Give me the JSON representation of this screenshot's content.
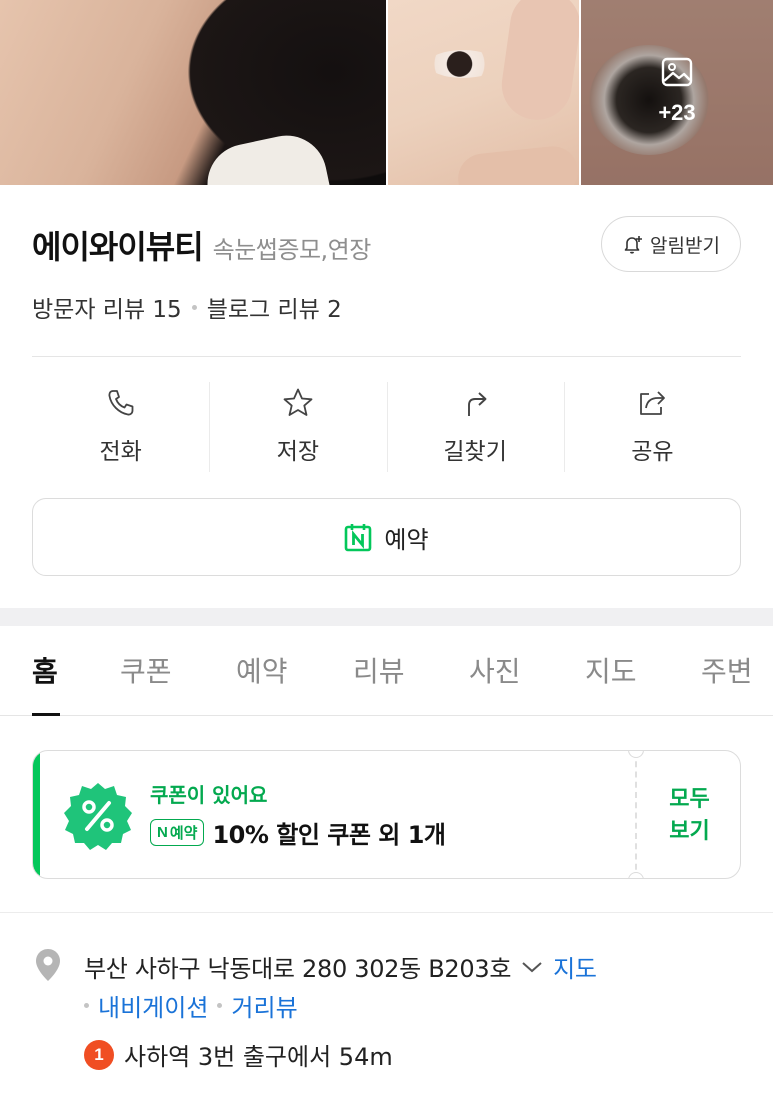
{
  "gallery": {
    "more_count": "+23"
  },
  "place": {
    "name": "에이와이뷰티",
    "category": "속눈썹증모,연장",
    "alarm_label": "알림받기",
    "visitor_reviews": "방문자 리뷰 15",
    "blog_reviews": "블로그 리뷰 2"
  },
  "actions": [
    {
      "label": "전화",
      "icon": "phone-icon"
    },
    {
      "label": "저장",
      "icon": "star-icon"
    },
    {
      "label": "길찾기",
      "icon": "directions-icon"
    },
    {
      "label": "공유",
      "icon": "share-icon"
    }
  ],
  "reserve_label": "예약",
  "tabs": [
    "홈",
    "쿠폰",
    "예약",
    "리뷰",
    "사진",
    "지도",
    "주변"
  ],
  "coupon": {
    "headline": "쿠폰이 있어요",
    "tag_n": "N",
    "tag_label": "예약",
    "text": "10% 할인 쿠폰 외 1개",
    "view_all": "모두 보기"
  },
  "location": {
    "address": "부산 사하구 낙동대로 280 302동 B203호",
    "map_link": "지도",
    "navigation_link": "내비게이션",
    "streetview_link": "거리뷰",
    "subway_line": "1",
    "station_text": "사하역 3번 출구에서 54m"
  },
  "colors": {
    "accent_green": "#03c75a",
    "link_blue": "#1a73d8",
    "subway_line1": "#f04e23"
  }
}
